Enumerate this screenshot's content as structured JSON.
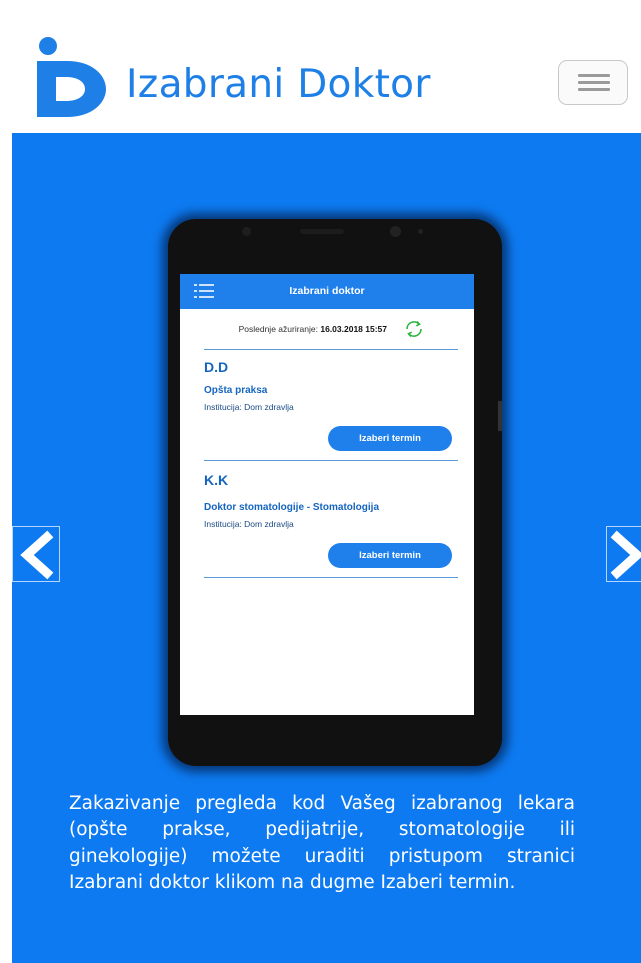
{
  "header": {
    "brand_name": "Izabrani Doktor",
    "logo_icon": "izabrani-doktor-logo",
    "menu_icon": "hamburger-icon",
    "accent_color": "#1E7FE6"
  },
  "hero": {
    "background_color": "#0D7AF1",
    "prev_icon": "chevron-left-icon",
    "next_icon": "chevron-right-icon",
    "caption": "Zakazivanje pregleda kod Vašeg izabranog lekara (opšte prakse, pedijatrije, stomatologije ili ginekologije) možete uraditi pristupom stranici Izabrani doktor klikom na dugme Izaberi termin."
  },
  "phone_app": {
    "title": "Izabrani doktor",
    "menu_icon": "list-menu-icon",
    "last_update_label": "Poslednje ažuriranje:",
    "last_update_value": "16.03.2018 15:57",
    "refresh_icon": "refresh-icon",
    "doctors": [
      {
        "name": "D.D",
        "specialty": "Opšta praksa",
        "institution": "Institucija: Dom zdravlja",
        "button_label": "Izaberi termin"
      },
      {
        "name": "K.K",
        "specialty": "Doktor stomatologije - Stomatologija",
        "institution": "Institucija: Dom zdravlja",
        "button_label": "Izaberi termin"
      }
    ]
  }
}
